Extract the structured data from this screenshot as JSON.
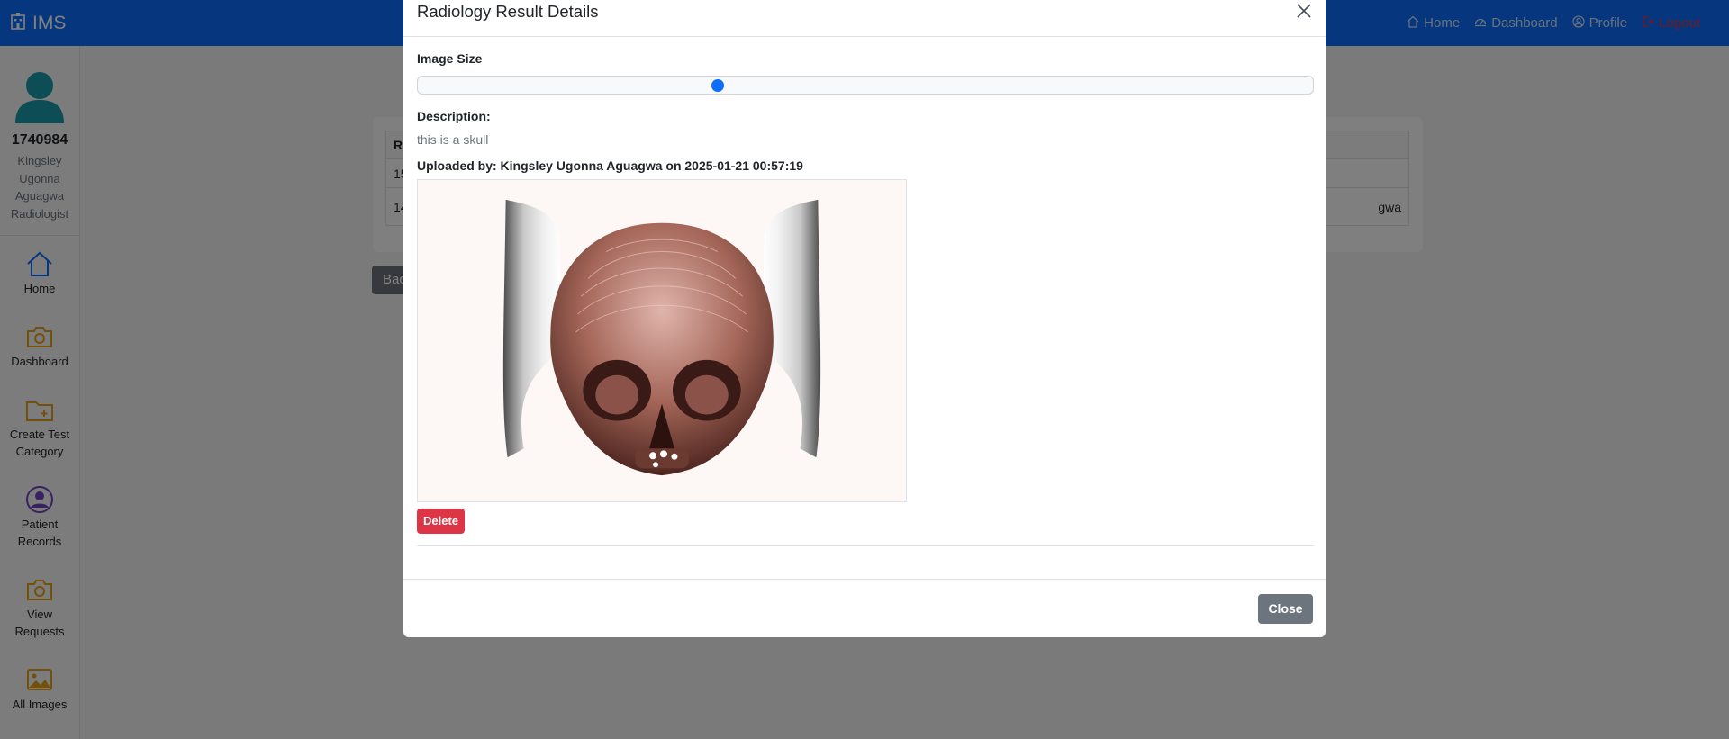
{
  "navbar": {
    "brand": "IMS",
    "links": [
      {
        "label": "Home",
        "icon": "home-icon"
      },
      {
        "label": "Dashboard",
        "icon": "dashboard-icon"
      },
      {
        "label": "Profile",
        "icon": "profile-icon"
      },
      {
        "label": "Logout",
        "icon": "logout-icon"
      }
    ]
  },
  "sidebar": {
    "user_id": "1740984",
    "user_name_lines": [
      "Kingsley",
      "Ugonna",
      "Aguagwa",
      "Radiologist"
    ],
    "items": [
      {
        "label_lines": [
          "Home"
        ],
        "icon": "home-icon"
      },
      {
        "label_lines": [
          "Dashboard"
        ],
        "icon": "camera-icon"
      },
      {
        "label_lines": [
          "Create Test",
          "Category"
        ],
        "icon": "folder-plus-icon"
      },
      {
        "label_lines": [
          "Patient",
          "Records"
        ],
        "icon": "user-circle-icon"
      },
      {
        "label_lines": [
          "View",
          "Requests"
        ],
        "icon": "camera-icon"
      },
      {
        "label_lines": [
          "All Images"
        ],
        "icon": "image-icon"
      }
    ]
  },
  "background": {
    "table_header_fragment": "Re",
    "row1_fragment": "15",
    "row2_fragment": "14",
    "row2_end_fragment": "gwa",
    "back_button_fragment": "Bac"
  },
  "modal": {
    "title": "Radiology Result Details",
    "image_size_label": "Image Size",
    "slider_value_percent": 33.5,
    "description_label": "Description:",
    "description_text": "this is a skull",
    "uploaded_by": "Uploaded by: Kingsley Ugonna Aguagwa on 2025-01-21 00:57:19",
    "delete_label": "Delete",
    "close_label": "Close"
  },
  "colors": {
    "primary": "#0d6efd",
    "danger": "#dc3545",
    "secondary": "#6c757d",
    "teal": "#1b9aaa",
    "amber": "#e8a317",
    "purple": "#6f42c1"
  }
}
